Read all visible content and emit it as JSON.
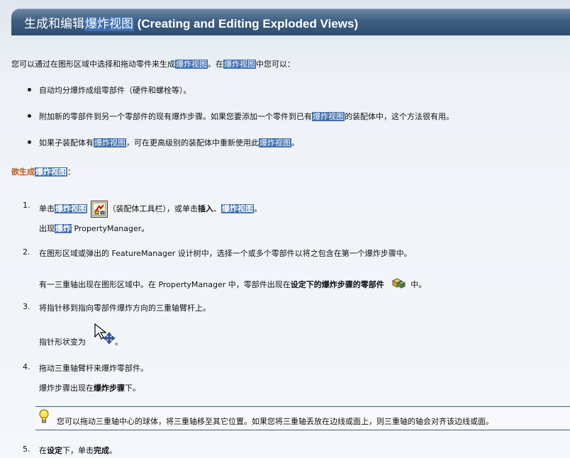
{
  "banner": {
    "title_cn_prefix": "生成和编辑",
    "title_cn_hl": "爆炸视图",
    "title_en": " (Creating and Editing Exploded Views)"
  },
  "intro": {
    "part1": "您可以通过在图形区域中选择和拖动零件来生成",
    "hl1": "爆炸视图",
    "part2": "。在",
    "hl2": "爆炸视图",
    "part3": "中您可以："
  },
  "bullets": [
    {
      "text": "自动均分爆炸成组零部件（硬件和螺栓等）。"
    },
    {
      "pre": "附加新的零部件到另一个零部件的现有爆炸步骤。如果您要添加一个零件到已有",
      "hl": "爆炸视图",
      "post": "的装配体中，这个方法很有用。"
    },
    {
      "pre": "如果子装配体有",
      "hl": "爆炸视图",
      "mid": "，可在更高级别的装配体中重新使用此",
      "hl2": "爆炸视图",
      "post": "。"
    }
  ],
  "procedure_heading": {
    "pre": "欲生成",
    "hl": "爆炸视图",
    "post": "："
  },
  "steps": [
    {
      "num": "1.",
      "pre": "单击",
      "hl": "爆炸视图",
      "mid": "（装配体工具栏），或单击",
      "bold1": "插入",
      "sep": "、",
      "hl2": "爆炸视图",
      "post": "。",
      "sub_pre": "出现",
      "sub_hl": "爆炸",
      "sub_post": " PropertyManager。"
    },
    {
      "num": "2.",
      "text": "在图形区域或弹出的 FeatureManager 设计树中，选择一个或多个零部件以将之包含在第一个爆炸步骤中。",
      "sub_pre": "有一三重轴出现在图形区域中。在 PropertyManager 中，零部件出现在",
      "sub_bold1": "设定下的",
      "sub_bold2": "爆炸步骤的零部件",
      "sub_post": "中。"
    },
    {
      "num": "3.",
      "text": "将指针移到指向零部件爆炸方向的三重轴臂杆上。",
      "sub_pre": "指针形状变为",
      "sub_post": "。"
    },
    {
      "num": "4.",
      "text": "拖动三重轴臂杆来爆炸零部件。",
      "sub_pre": "爆炸步骤出现在",
      "sub_bold1": "爆炸步骤",
      "sub_post": "下。"
    },
    {
      "num": "5.",
      "pre": "在",
      "bold1": "设定",
      "mid": "下，单击",
      "bold2": "完成",
      "post": "。"
    }
  ],
  "note": {
    "text": "您可以拖动三重轴中心的球体，将三重轴移至其它位置。如果您将三重轴丢放在边线或面上，则三重轴的轴会对齐该边线或面。"
  },
  "icons": {
    "explode_toolbar": "explode-view-icon",
    "components": "components-icon",
    "pointer": "move-pointer-icon",
    "tip": "lightbulb-icon"
  }
}
